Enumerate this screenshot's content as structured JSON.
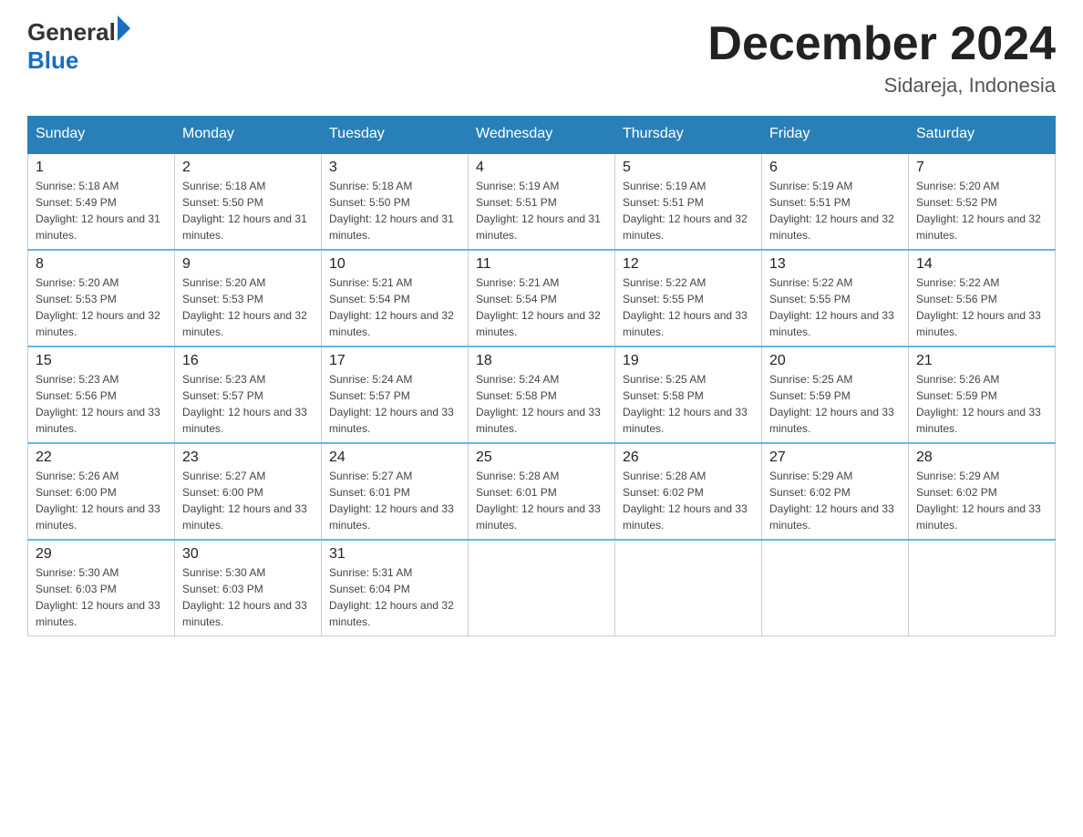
{
  "header": {
    "logo_general": "General",
    "logo_blue": "Blue",
    "month_title": "December 2024",
    "location": "Sidareja, Indonesia"
  },
  "weekdays": [
    "Sunday",
    "Monday",
    "Tuesday",
    "Wednesday",
    "Thursday",
    "Friday",
    "Saturday"
  ],
  "weeks": [
    [
      {
        "day": "1",
        "sunrise": "5:18 AM",
        "sunset": "5:49 PM",
        "daylight": "12 hours and 31 minutes."
      },
      {
        "day": "2",
        "sunrise": "5:18 AM",
        "sunset": "5:50 PM",
        "daylight": "12 hours and 31 minutes."
      },
      {
        "day": "3",
        "sunrise": "5:18 AM",
        "sunset": "5:50 PM",
        "daylight": "12 hours and 31 minutes."
      },
      {
        "day": "4",
        "sunrise": "5:19 AM",
        "sunset": "5:51 PM",
        "daylight": "12 hours and 31 minutes."
      },
      {
        "day": "5",
        "sunrise": "5:19 AM",
        "sunset": "5:51 PM",
        "daylight": "12 hours and 32 minutes."
      },
      {
        "day": "6",
        "sunrise": "5:19 AM",
        "sunset": "5:51 PM",
        "daylight": "12 hours and 32 minutes."
      },
      {
        "day": "7",
        "sunrise": "5:20 AM",
        "sunset": "5:52 PM",
        "daylight": "12 hours and 32 minutes."
      }
    ],
    [
      {
        "day": "8",
        "sunrise": "5:20 AM",
        "sunset": "5:53 PM",
        "daylight": "12 hours and 32 minutes."
      },
      {
        "day": "9",
        "sunrise": "5:20 AM",
        "sunset": "5:53 PM",
        "daylight": "12 hours and 32 minutes."
      },
      {
        "day": "10",
        "sunrise": "5:21 AM",
        "sunset": "5:54 PM",
        "daylight": "12 hours and 32 minutes."
      },
      {
        "day": "11",
        "sunrise": "5:21 AM",
        "sunset": "5:54 PM",
        "daylight": "12 hours and 32 minutes."
      },
      {
        "day": "12",
        "sunrise": "5:22 AM",
        "sunset": "5:55 PM",
        "daylight": "12 hours and 33 minutes."
      },
      {
        "day": "13",
        "sunrise": "5:22 AM",
        "sunset": "5:55 PM",
        "daylight": "12 hours and 33 minutes."
      },
      {
        "day": "14",
        "sunrise": "5:22 AM",
        "sunset": "5:56 PM",
        "daylight": "12 hours and 33 minutes."
      }
    ],
    [
      {
        "day": "15",
        "sunrise": "5:23 AM",
        "sunset": "5:56 PM",
        "daylight": "12 hours and 33 minutes."
      },
      {
        "day": "16",
        "sunrise": "5:23 AM",
        "sunset": "5:57 PM",
        "daylight": "12 hours and 33 minutes."
      },
      {
        "day": "17",
        "sunrise": "5:24 AM",
        "sunset": "5:57 PM",
        "daylight": "12 hours and 33 minutes."
      },
      {
        "day": "18",
        "sunrise": "5:24 AM",
        "sunset": "5:58 PM",
        "daylight": "12 hours and 33 minutes."
      },
      {
        "day": "19",
        "sunrise": "5:25 AM",
        "sunset": "5:58 PM",
        "daylight": "12 hours and 33 minutes."
      },
      {
        "day": "20",
        "sunrise": "5:25 AM",
        "sunset": "5:59 PM",
        "daylight": "12 hours and 33 minutes."
      },
      {
        "day": "21",
        "sunrise": "5:26 AM",
        "sunset": "5:59 PM",
        "daylight": "12 hours and 33 minutes."
      }
    ],
    [
      {
        "day": "22",
        "sunrise": "5:26 AM",
        "sunset": "6:00 PM",
        "daylight": "12 hours and 33 minutes."
      },
      {
        "day": "23",
        "sunrise": "5:27 AM",
        "sunset": "6:00 PM",
        "daylight": "12 hours and 33 minutes."
      },
      {
        "day": "24",
        "sunrise": "5:27 AM",
        "sunset": "6:01 PM",
        "daylight": "12 hours and 33 minutes."
      },
      {
        "day": "25",
        "sunrise": "5:28 AM",
        "sunset": "6:01 PM",
        "daylight": "12 hours and 33 minutes."
      },
      {
        "day": "26",
        "sunrise": "5:28 AM",
        "sunset": "6:02 PM",
        "daylight": "12 hours and 33 minutes."
      },
      {
        "day": "27",
        "sunrise": "5:29 AM",
        "sunset": "6:02 PM",
        "daylight": "12 hours and 33 minutes."
      },
      {
        "day": "28",
        "sunrise": "5:29 AM",
        "sunset": "6:02 PM",
        "daylight": "12 hours and 33 minutes."
      }
    ],
    [
      {
        "day": "29",
        "sunrise": "5:30 AM",
        "sunset": "6:03 PM",
        "daylight": "12 hours and 33 minutes."
      },
      {
        "day": "30",
        "sunrise": "5:30 AM",
        "sunset": "6:03 PM",
        "daylight": "12 hours and 33 minutes."
      },
      {
        "day": "31",
        "sunrise": "5:31 AM",
        "sunset": "6:04 PM",
        "daylight": "12 hours and 32 minutes."
      },
      null,
      null,
      null,
      null
    ]
  ]
}
